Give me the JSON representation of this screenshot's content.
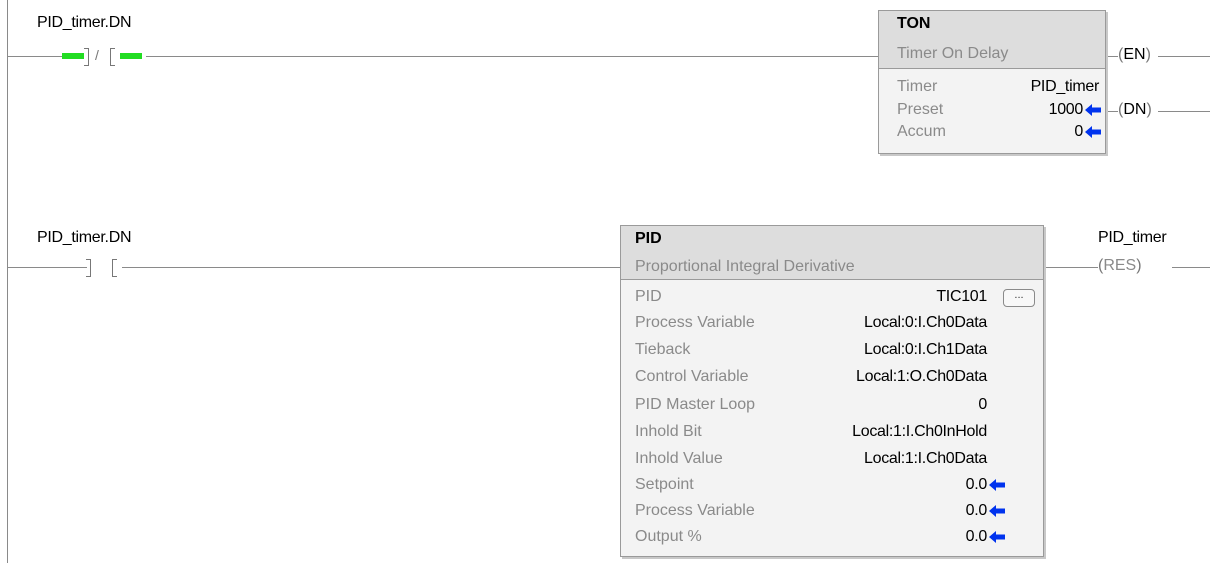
{
  "rung0": {
    "contact_tag": "PID_timer.DN",
    "ton": {
      "title": "TON",
      "subtitle": "Timer On Delay",
      "rows": [
        {
          "label": "Timer",
          "value": "PID_timer"
        },
        {
          "label": "Preset",
          "value": "1000"
        },
        {
          "label": "Accum",
          "value": "0"
        }
      ]
    },
    "coil_en": "EN",
    "coil_dn": "DN"
  },
  "rung1": {
    "contact_tag": "PID_timer.DN",
    "pid": {
      "title": "PID",
      "subtitle": "Proportional Integral Derivative",
      "rows": [
        {
          "label": "PID",
          "value": "TIC101"
        },
        {
          "label": "Process Variable",
          "value": "Local:0:I.Ch0Data"
        },
        {
          "label": "Tieback",
          "value": "Local:0:I.Ch1Data"
        },
        {
          "label": "Control Variable",
          "value": "Local:1:O.Ch0Data"
        },
        {
          "label": "PID Master Loop",
          "value": "0"
        },
        {
          "label": "Inhold Bit",
          "value": "Local:1:I.Ch0InHold"
        },
        {
          "label": "Inhold Value",
          "value": "Local:1:I.Ch0Data"
        },
        {
          "label": "Setpoint",
          "value": "0.0"
        },
        {
          "label": "Process Variable",
          "value": "0.0"
        },
        {
          "label": "Output %",
          "value": "0.0"
        }
      ],
      "dots_label": "..."
    },
    "coil_tag": "PID_timer",
    "coil_res": "RES"
  },
  "colors": {
    "energized": "#22dd22",
    "arrow": "#0033ee",
    "wire": "#8a8a8a"
  }
}
